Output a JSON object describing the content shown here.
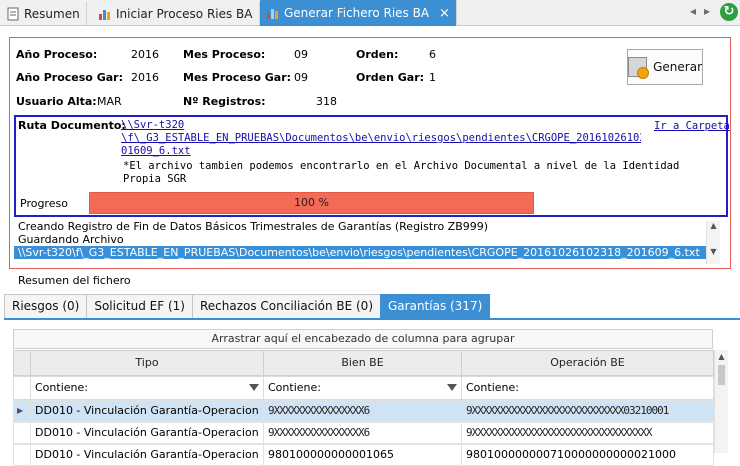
{
  "tabs": [
    {
      "label": "Resumen"
    },
    {
      "label": "Iniciar Proceso Ries BA"
    },
    {
      "label": "Generar Fichero Ries BA"
    }
  ],
  "header": {
    "anio_proceso_label": "Año Proceso:",
    "anio_proceso_value": "2016",
    "mes_proceso_label": "Mes Proceso:",
    "mes_proceso_value": "09",
    "orden_label": "Orden:",
    "orden_value": "6",
    "anio_gar_label": "Año Proceso Gar:",
    "anio_gar_value": "2016",
    "mes_gar_label": "Mes Proceso Gar:",
    "mes_gar_value": "09",
    "orden_gar_label": "Orden Gar:",
    "orden_gar_value": "1",
    "usuario_label": "Usuario Alta:",
    "usuario_value": "MAR",
    "registros_label": "Nº Registros:",
    "registros_value": "318",
    "generar_label": "Generar"
  },
  "ruta": {
    "label": "Ruta Documento:",
    "line1": "\\\\Svr-t320",
    "line2": "\\f\\_G3_ESTABLE_EN_PRUEBAS\\Documentos\\be\\envio\\riesgos\\pendientes\\CRGOPE_20161026102318_2",
    "line3": "01609_6.txt",
    "ir_carpeta": "Ir a Carpeta",
    "note1": "*El archivo tambien podemos encontrarlo en el Archivo Documental a nivel de la Identidad de la",
    "note2": "Propia SGR"
  },
  "progress": {
    "label": "Progreso",
    "percent": 100,
    "text": "100 %"
  },
  "log": {
    "line1": "Creando Registro de Fin de Datos Básicos Trimestrales de Garantías (Registro ZB999)",
    "line2": "Guardando Archivo",
    "line3": "\\\\Svr-t320\\f\\_G3_ESTABLE_EN_PRUEBAS\\Documentos\\be\\envio\\riesgos\\pendientes\\CRGOPE_20161026102318_201609_6.txt"
  },
  "resumen_label": "Resumen del fichero",
  "bottom_tabs": [
    {
      "label": "Riesgos (0)"
    },
    {
      "label": "Solicitud EF (1)"
    },
    {
      "label": "Rechazos Conciliación BE (0)"
    },
    {
      "label": "Garantías (317)"
    }
  ],
  "grid": {
    "group_hint": "Arrastrar aquí el encabezado de columna para agrupar",
    "columns": [
      "Tipo",
      "Bien BE",
      "Operación BE"
    ],
    "filter_label": "Contiene:",
    "rows": [
      {
        "tipo": "DD010 - Vinculación Garantía-Operacion",
        "bien": "9XXXXXXXXXXXXXXXX6",
        "op": "9XXXXXXXXXXXXXXXXXXXXXXXXXXX03210001"
      },
      {
        "tipo": "DD010 - Vinculación Garantía-Operacion",
        "bien": "9XXXXXXXXXXXXXXXX6",
        "op": "9XXXXXXXXXXXXXXXXXXXXXXXXXXXXXXXX"
      },
      {
        "tipo": "DD010 - Vinculación Garantía-Operacion",
        "bien": "980100000000001065",
        "op": "980100000000710000000000021000"
      }
    ]
  },
  "colors": {
    "accent": "#3c8fd3",
    "progress": "#f36b56",
    "panel_border": "#e05c5c",
    "route_border": "#2020c8"
  }
}
